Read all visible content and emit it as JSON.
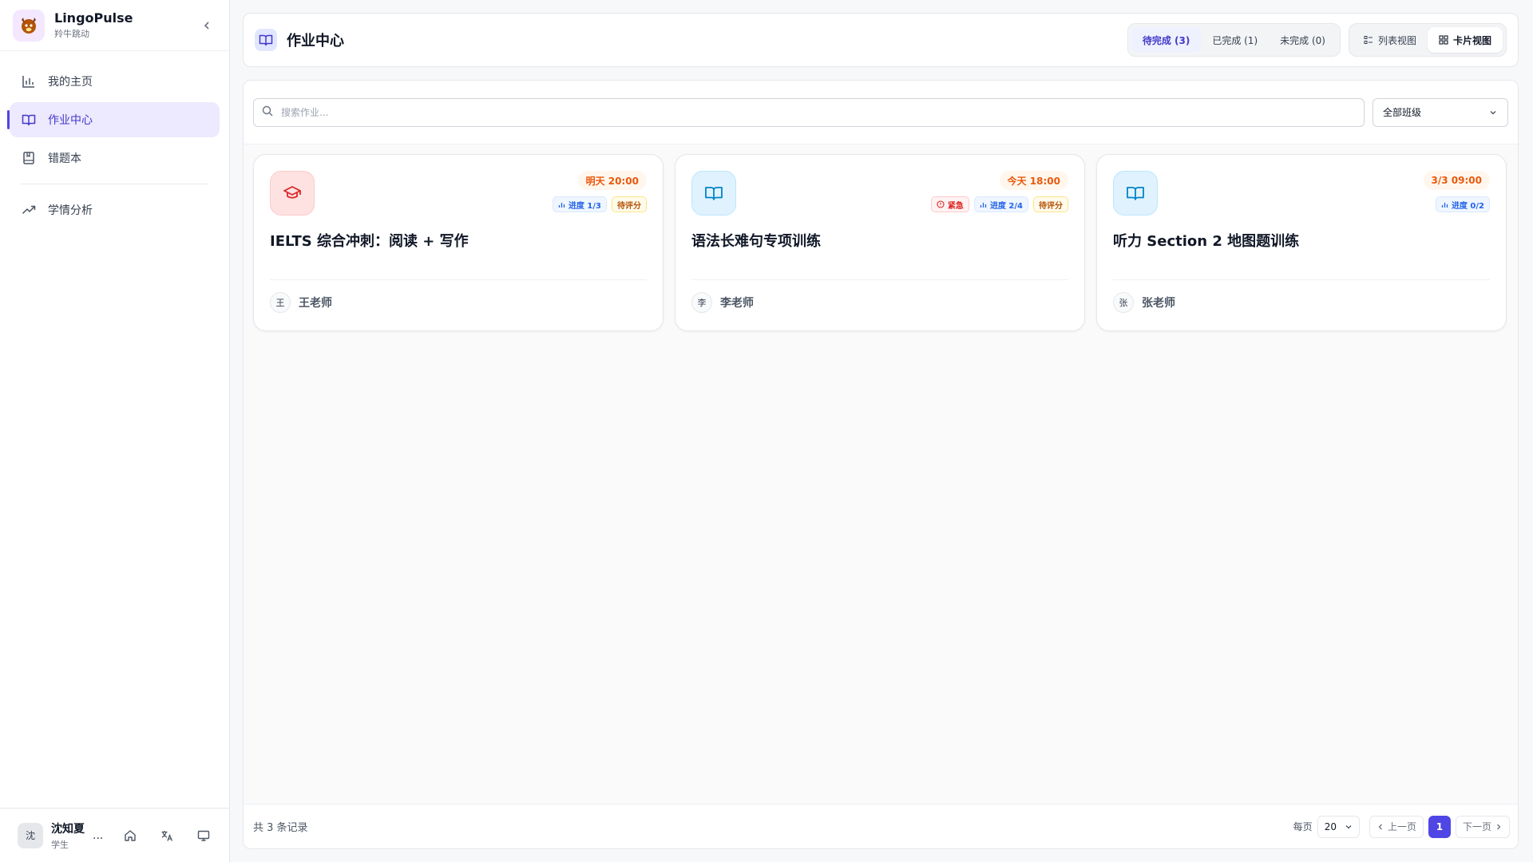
{
  "app": {
    "name": "LingoPulse",
    "subtitle": "羚牛跳动"
  },
  "sidebar": {
    "items": [
      {
        "label": "我的主页",
        "icon": "bar-chart-icon"
      },
      {
        "label": "作业中心",
        "icon": "book-open-icon",
        "active": true
      },
      {
        "label": "错题本",
        "icon": "notebook-icon"
      },
      {
        "label": "学情分析",
        "icon": "trending-up-icon"
      }
    ]
  },
  "user": {
    "avatar": "沈",
    "name": "沈知夏",
    "role": "学生",
    "more": "..."
  },
  "header": {
    "title": "作业中心",
    "status_tabs": [
      "待完成 (3)",
      "已完成 (1)",
      "未完成 (0)"
    ],
    "view_list": "列表视图",
    "view_card": "卡片视图"
  },
  "filter": {
    "search_placeholder": "搜索作业...",
    "class_select": "全部班级"
  },
  "cards": [
    {
      "title": "IELTS 综合冲刺：阅读 + 写作",
      "due": "明天 20:00",
      "icon": "graduation-cap-icon",
      "urgent": "",
      "progress": "进度 1/3",
      "status": "待评分",
      "teacher_initial": "王",
      "teacher": "王老师"
    },
    {
      "title": "语法长难句专项训练",
      "due": "今天 18:00",
      "icon": "book-open-icon",
      "urgent": "紧急",
      "progress": "进度 2/4",
      "status": "待评分",
      "teacher_initial": "李",
      "teacher": "李老师"
    },
    {
      "title": "听力 Section 2 地图题训练",
      "due": "3/3 09:00",
      "icon": "book-open-icon",
      "urgent": "",
      "progress": "进度 0/2",
      "status": "",
      "teacher_initial": "张",
      "teacher": "张老师"
    }
  ],
  "pagination": {
    "total": "共 3 条记录",
    "per_page_label": "每页",
    "per_page": "20",
    "prev": "上一页",
    "current": "1",
    "next": "下一页"
  },
  "colors": {
    "accent": "#4f46e5",
    "due": "#ea580c",
    "urgent": "#dc2626"
  }
}
